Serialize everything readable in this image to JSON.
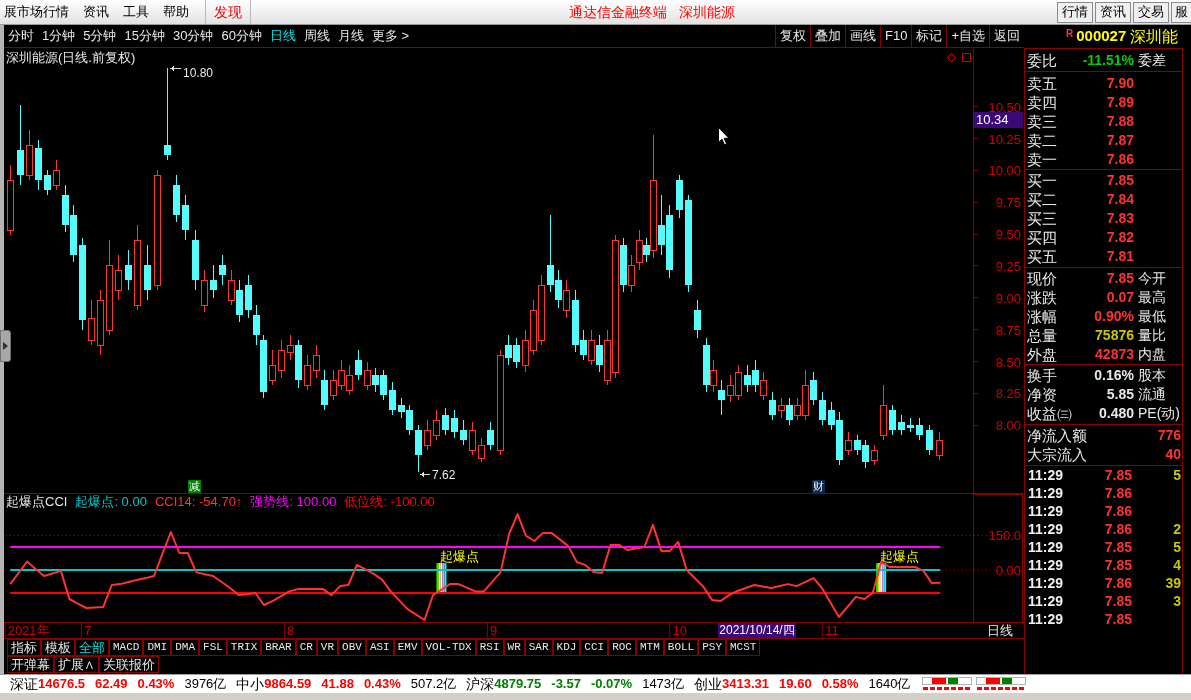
{
  "menu_bar": {
    "items": [
      "展市场行情",
      "资讯",
      "工具",
      "帮助"
    ],
    "discover": "发现",
    "app_title": "通达信金融终端",
    "stock_title": "深圳能源",
    "buttons": [
      "行情",
      "资讯",
      "交易",
      "服"
    ]
  },
  "toolbar": {
    "periods": [
      {
        "label": "分时",
        "selected": false
      },
      {
        "label": "1分钟",
        "selected": false
      },
      {
        "label": "5分钟",
        "selected": false
      },
      {
        "label": "15分钟",
        "selected": false
      },
      {
        "label": "30分钟",
        "selected": false
      },
      {
        "label": "60分钟",
        "selected": false
      },
      {
        "label": "日线",
        "selected": true
      },
      {
        "label": "周线",
        "selected": false
      },
      {
        "label": "月线",
        "selected": false
      },
      {
        "label": "更多 >",
        "selected": false
      }
    ],
    "actions": [
      "复权",
      "叠加",
      "画线",
      "F10",
      "标记",
      "+自选",
      "返回"
    ]
  },
  "quote_header": {
    "badge": "R",
    "code": "000027",
    "name": "深圳能"
  },
  "price_chart": {
    "title": "深圳能源(日线.前复权)",
    "axis_labels": [
      "10.50",
      "10.25",
      "10.00",
      "9.75",
      "9.50",
      "9.25",
      "9.00",
      "8.75",
      "8.50",
      "8.25",
      "8.00"
    ],
    "cursor_price": "10.34",
    "high_label": "10.80",
    "low_label": "7.62",
    "events": [
      {
        "text": "减",
        "color": "#008000"
      },
      {
        "text": "财",
        "color": "#0a2850"
      }
    ]
  },
  "cci_panel": {
    "name": "起爆点CCI",
    "readings": [
      ": 0.00",
      ": -54.70↑",
      ": 100.00",
      ": -100.00"
    ],
    "period_label": "日线",
    "cursor_date": "2021/10/14/四",
    "chart_data": {
      "type": "line",
      "categories": [
        null,
        null,
        "2021年",
        null,
        null,
        null,
        null,
        null,
        null,
        "7",
        null,
        null,
        null,
        null,
        null,
        null,
        null,
        null,
        null,
        null,
        null,
        null,
        null,
        null,
        null,
        null,
        null,
        null,
        null,
        null,
        null,
        null,
        null,
        "8",
        null,
        null,
        null,
        null,
        null,
        null,
        null,
        null,
        null,
        null,
        null,
        null,
        null,
        null,
        null,
        null,
        null,
        null,
        null,
        null,
        null,
        null,
        null,
        "9",
        null,
        null,
        null,
        null,
        null,
        null,
        null,
        null,
        null,
        null,
        null,
        null,
        null,
        null,
        null,
        null,
        null,
        null,
        null,
        null,
        null,
        "10",
        null,
        null,
        null,
        null,
        null,
        null,
        null,
        null,
        null,
        null,
        null,
        null,
        null,
        null,
        null,
        null,
        null,
        "11",
        null,
        null,
        null,
        null,
        null,
        null,
        null,
        null,
        null,
        null,
        null,
        null,
        null
      ],
      "series": [
        {
          "name": "起爆点",
          "color": "#00c8c8",
          "values": [
            0,
            0,
            0,
            0,
            0,
            0,
            0,
            0,
            0,
            0,
            0,
            0,
            0,
            0,
            0,
            0,
            0,
            0,
            0,
            0,
            0,
            0,
            0,
            0,
            0,
            0,
            0,
            0,
            0,
            0,
            0,
            0,
            0,
            0,
            0,
            0,
            0,
            0,
            0,
            0,
            0,
            0,
            0,
            0,
            0,
            0,
            0,
            0,
            0,
            0,
            0,
            0,
            0,
            0,
            0,
            0,
            0,
            0,
            0,
            0,
            0,
            0,
            0,
            0,
            0,
            0,
            0,
            0,
            0,
            0,
            0,
            0,
            0,
            0,
            0,
            0,
            0,
            0,
            0,
            0,
            0,
            0,
            0,
            0,
            0,
            0,
            0,
            0,
            0,
            0,
            0,
            0,
            0,
            0,
            0,
            0,
            0,
            0,
            0,
            0,
            0,
            0,
            0,
            0,
            0,
            0,
            0,
            0,
            0,
            0,
            0
          ]
        },
        {
          "name": "CCI14",
          "color": "#ff3232",
          "values": [
            -61,
            -12,
            37,
            5,
            -26,
            -15,
            -4,
            -126,
            -146,
            -165,
            -163,
            -161,
            -65,
            -61,
            -52,
            -43,
            -35,
            -26,
            70,
            165,
            74,
            74,
            -9,
            -18,
            -26,
            -52,
            -78,
            -109,
            -105,
            -100,
            -152,
            -135,
            -114,
            -93,
            -83,
            -83,
            -83,
            -83,
            -109,
            -70,
            -65,
            22,
            3,
            -17,
            -43,
            -93,
            -132,
            -170,
            -194,
            -217,
            -109,
            -85,
            -61,
            -61,
            -77,
            -93,
            -93,
            -51,
            -9,
            157,
            243,
            148,
            126,
            161,
            161,
            133,
            104,
            35,
            22,
            -9,
            -13,
            109,
            109,
            87,
            94,
            100,
            196,
            83,
            83,
            122,
            0,
            -37,
            -74,
            -130,
            -135,
            -109,
            -91,
            -78,
            -65,
            -72,
            -78,
            -70,
            -61,
            -70,
            -53,
            -35,
            -78,
            -141,
            -204,
            -161,
            -117,
            -126,
            -100,
            35,
            13,
            13,
            13,
            13,
            -4,
            -57,
            -55
          ]
        },
        {
          "name": "强势线",
          "color": "#ff00ff",
          "values": [
            100,
            100,
            100,
            100,
            100,
            100,
            100,
            100,
            100,
            100,
            100,
            100,
            100,
            100,
            100,
            100,
            100,
            100,
            100,
            100,
            100,
            100,
            100,
            100,
            100,
            100,
            100,
            100,
            100,
            100,
            100,
            100,
            100,
            100,
            100,
            100,
            100,
            100,
            100,
            100,
            100,
            100,
            100,
            100,
            100,
            100,
            100,
            100,
            100,
            100,
            100,
            100,
            100,
            100,
            100,
            100,
            100,
            100,
            100,
            100,
            100,
            100,
            100,
            100,
            100,
            100,
            100,
            100,
            100,
            100,
            100,
            100,
            100,
            100,
            100,
            100,
            100,
            100,
            100,
            100,
            100,
            100,
            100,
            100,
            100,
            100,
            100,
            100,
            100,
            100,
            100,
            100,
            100,
            100,
            100,
            100,
            100,
            100,
            100,
            100,
            100,
            100,
            100,
            100,
            100,
            100,
            100,
            100,
            100,
            100,
            100
          ]
        },
        {
          "name": "低位线",
          "color": "#ff0000",
          "values": [
            -100,
            -100,
            -100,
            -100,
            -100,
            -100,
            -100,
            -100,
            -100,
            -100,
            -100,
            -100,
            -100,
            -100,
            -100,
            -100,
            -100,
            -100,
            -100,
            -100,
            -100,
            -100,
            -100,
            -100,
            -100,
            -100,
            -100,
            -100,
            -100,
            -100,
            -100,
            -100,
            -100,
            -100,
            -100,
            -100,
            -100,
            -100,
            -100,
            -100,
            -100,
            -100,
            -100,
            -100,
            -100,
            -100,
            -100,
            -100,
            -100,
            -100,
            -100,
            -100,
            -100,
            -100,
            -100,
            -100,
            -100,
            -100,
            -100,
            -100,
            -100,
            -100,
            -100,
            -100,
            -100,
            -100,
            -100,
            -100,
            -100,
            -100,
            -100,
            -100,
            -100,
            -100,
            -100,
            -100,
            -100,
            -100,
            -100,
            -100,
            -100,
            -100,
            -100,
            -100,
            -100,
            -100,
            -100,
            -100,
            -100,
            -100,
            -100,
            -100,
            -100,
            -100,
            -100,
            -100,
            -100,
            -100,
            -100,
            -100,
            -100,
            -100,
            -100,
            -100,
            -100,
            -100,
            -100,
            -100,
            -100,
            -100,
            -100
          ]
        }
      ],
      "ylim": [
        -228,
        328
      ],
      "yticks": [
        {
          "value": 150,
          "label": "150.0"
        },
        {
          "value": 0,
          "label": "0.00"
        }
      ],
      "annotations": [
        "起爆点",
        "起爆点"
      ]
    }
  },
  "indicator_tabs": [
    {
      "label": "指标",
      "selected": false,
      "kind": "group"
    },
    {
      "label": "模板",
      "selected": false,
      "kind": "group"
    },
    {
      "label": "全部",
      "selected": true,
      "kind": "group"
    },
    {
      "label": "MACD",
      "selected": false,
      "kind": "indicator"
    },
    {
      "label": "DMI",
      "selected": false,
      "kind": "indicator"
    },
    {
      "label": "DMA",
      "selected": false,
      "kind": "indicator"
    },
    {
      "label": "FSL",
      "selected": false,
      "kind": "indicator"
    },
    {
      "label": "TRIX",
      "selected": false,
      "kind": "indicator"
    },
    {
      "label": "BRAR",
      "selected": false,
      "kind": "indicator"
    },
    {
      "label": "CR",
      "selected": false,
      "kind": "indicator"
    },
    {
      "label": "VR",
      "selected": false,
      "kind": "indicator"
    },
    {
      "label": "OBV",
      "selected": false,
      "kind": "indicator"
    },
    {
      "label": "ASI",
      "selected": false,
      "kind": "indicator"
    },
    {
      "label": "EMV",
      "selected": false,
      "kind": "indicator"
    },
    {
      "label": "VOL-TDX",
      "selected": false,
      "kind": "indicator"
    },
    {
      "label": "RSI",
      "selected": false,
      "kind": "indicator"
    },
    {
      "label": "WR",
      "selected": false,
      "kind": "indicator"
    },
    {
      "label": "SAR",
      "selected": false,
      "kind": "indicator"
    },
    {
      "label": "KDJ",
      "selected": false,
      "kind": "indicator"
    },
    {
      "label": "CCI",
      "selected": false,
      "kind": "indicator"
    },
    {
      "label": "ROC",
      "selected": false,
      "kind": "indicator"
    },
    {
      "label": "MTM",
      "selected": false,
      "kind": "indicator"
    },
    {
      "label": "BOLL",
      "selected": false,
      "kind": "indicator"
    },
    {
      "label": "PSY",
      "selected": false,
      "kind": "indicator"
    },
    {
      "label": "MCST",
      "selected": false,
      "kind": "indicator"
    }
  ],
  "extra_tabs": [
    "开弹幕",
    "扩展∧",
    "关联报价"
  ],
  "quote_panel": {
    "ratio": {
      "label": "委比",
      "value": "-11.51%",
      "label2": "委差"
    },
    "asks": [
      {
        "label": "卖五",
        "price": "7.90"
      },
      {
        "label": "卖四",
        "price": "7.89"
      },
      {
        "label": "卖三",
        "price": "7.88"
      },
      {
        "label": "卖二",
        "price": "7.87"
      },
      {
        "label": "卖一",
        "price": "7.86"
      }
    ],
    "bids": [
      {
        "label": "买一",
        "price": "7.85"
      },
      {
        "label": "买二",
        "price": "7.84"
      },
      {
        "label": "买三",
        "price": "7.83"
      },
      {
        "label": "买四",
        "price": "7.82"
      },
      {
        "label": "买五",
        "price": "7.81"
      }
    ],
    "stats": [
      {
        "label": "现价",
        "value": "7.85",
        "color": "#ff3232",
        "label2": "今开"
      },
      {
        "label": "涨跌",
        "value": "0.07",
        "color": "#ff3232",
        "label2": "最高"
      },
      {
        "label": "涨幅",
        "value": "0.90%",
        "color": "#ff3232",
        "label2": "最低"
      },
      {
        "label": "总量",
        "value": "75876",
        "color": "#c8c800",
        "label2": "量比"
      },
      {
        "label": "外盘",
        "value": "42873",
        "color": "#ff3232",
        "label2": "内盘"
      }
    ],
    "fundamentals": [
      {
        "label": "换手",
        "value": "0.16%",
        "label2": "股本"
      },
      {
        "label": "净资",
        "value": "5.85",
        "label2": "流通"
      },
      {
        "label": "收益㈢",
        "value": "0.480",
        "label2": "PE(动)"
      }
    ],
    "flows": [
      {
        "label": "净流入额",
        "value": "776"
      },
      {
        "label": "大宗流入",
        "value": "40"
      }
    ],
    "ticks": [
      {
        "time": "11:29",
        "price": "7.85",
        "volume": "5"
      },
      {
        "time": "11:29",
        "price": "7.86"
      },
      {
        "time": "11:29",
        "price": "7.86"
      },
      {
        "time": "11:29",
        "price": "7.86",
        "volume": "2"
      },
      {
        "time": "11:29",
        "price": "7.85",
        "volume": "5"
      },
      {
        "time": "11:29",
        "price": "7.85",
        "volume": "4"
      },
      {
        "time": "11:29",
        "price": "7.86",
        "volume": "39"
      },
      {
        "time": "11:29",
        "price": "7.85",
        "volume": "3"
      },
      {
        "time": "11:29",
        "price": "7.85"
      }
    ]
  },
  "status_bar": {
    "indices": [
      {
        "name": "深证",
        "value": "14676.5",
        "change": "62.49",
        "percent": "0.43%",
        "amount": "3976亿",
        "color": "#ff0000"
      },
      {
        "name": "中小",
        "value": "9864.59",
        "change": "41.88",
        "percent": "0.43%",
        "amount": "507.2亿",
        "color": "#ff0000"
      },
      {
        "name": "沪深",
        "value": "4879.75",
        "change": "-3.57",
        "percent": "-0.07%",
        "amount": "1473亿",
        "color": "#008000"
      },
      {
        "name": "创业",
        "value": "3413.31",
        "change": "19.60",
        "percent": "0.58%",
        "amount": "1640亿",
        "color": "#ff0000"
      }
    ]
  }
}
